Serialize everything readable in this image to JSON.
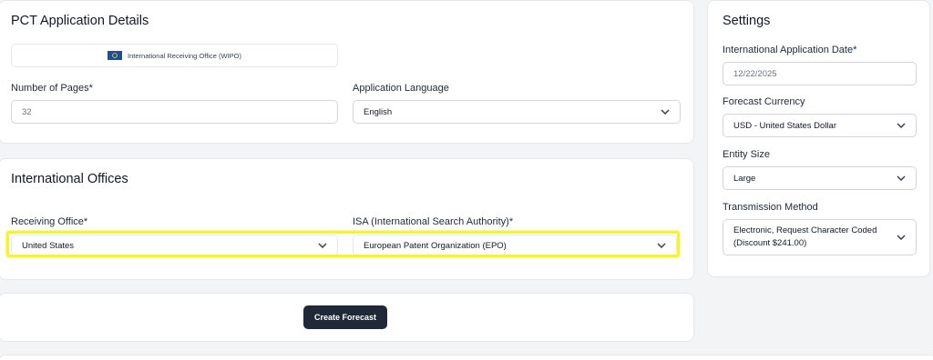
{
  "pct": {
    "title": "PCT Application Details",
    "office_badge": "International Receiving Office (WIPO)",
    "pages_label": "Number of Pages*",
    "pages_value": "32",
    "language_label": "Application Language",
    "language_value": "English"
  },
  "offices": {
    "title": "International Offices",
    "receiving_label": "Receiving Office*",
    "receiving_value": "United States",
    "isa_label": "ISA (International Search Authority)*",
    "isa_value": "European Patent Organization (EPO)"
  },
  "actions": {
    "create_label": "Create Forecast"
  },
  "settings": {
    "title": "Settings",
    "date_label": "International Application Date*",
    "date_value": "12/22/2025",
    "currency_label": "Forecast Currency",
    "currency_value": "USD - United States Dollar",
    "entity_label": "Entity Size",
    "entity_value": "Large",
    "transmission_label": "Transmission Method",
    "transmission_value": "Electronic, Request Character Coded (Discount $241.00)"
  },
  "icons": {
    "flag": "wipo-flag-icon",
    "chevron": "chevron-down-icon"
  },
  "colors": {
    "button_bg": "#1f2937",
    "highlight": "#f5f52a",
    "page_bg": "#f3f4f6"
  }
}
